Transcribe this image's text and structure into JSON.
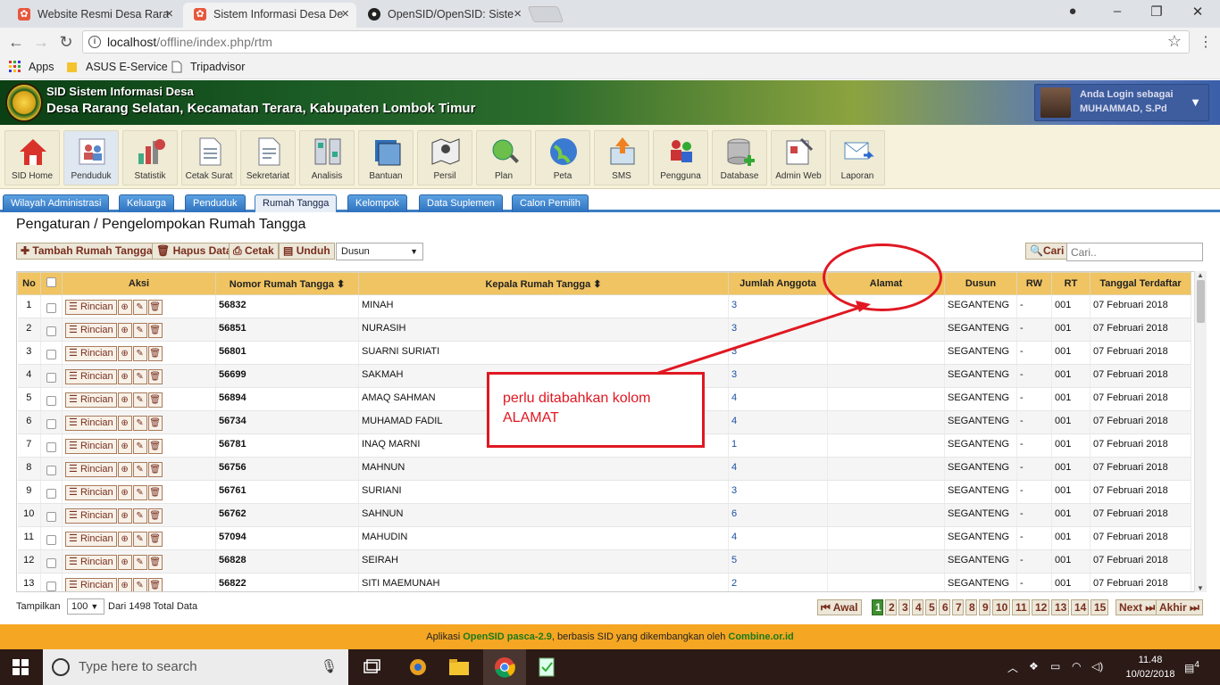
{
  "browser": {
    "tabs": [
      {
        "title": "Website Resmi Desa Rara",
        "favicon_color": "#d9443b"
      },
      {
        "title": "Sistem Informasi Desa De",
        "favicon_color": "#d9443b"
      },
      {
        "title": "OpenSID/OpenSID: Siste",
        "favicon_color": "#222222"
      }
    ],
    "url_host": "localhost",
    "url_path": "/offline/index.php/rtm",
    "bookmarks": [
      "Apps",
      "ASUS E-Service",
      "Tripadvisor"
    ]
  },
  "app": {
    "title": "SID Sistem Informasi Desa",
    "subtitle": "Desa Rarang Selatan, Kecamatan Terara, Kabupaten Lombok Timur",
    "login_label": "Anda Login sebagai",
    "user_name": "MUHAMMAD, S.Pd"
  },
  "modules": [
    {
      "label": "SID Home",
      "icon": "home-icon"
    },
    {
      "label": "Penduduk",
      "icon": "people-icon"
    },
    {
      "label": "Statistik",
      "icon": "chart-icon"
    },
    {
      "label": "Cetak Surat",
      "icon": "document-icon"
    },
    {
      "label": "Sekretariat",
      "icon": "document-icon"
    },
    {
      "label": "Analisis",
      "icon": "analysis-icon"
    },
    {
      "label": "Bantuan",
      "icon": "book-icon"
    },
    {
      "label": "Persil",
      "icon": "map-pin-icon"
    },
    {
      "label": "Plan",
      "icon": "plan-icon"
    },
    {
      "label": "Peta",
      "icon": "globe-icon"
    },
    {
      "label": "SMS",
      "icon": "sms-icon"
    },
    {
      "label": "Pengguna",
      "icon": "users-icon"
    },
    {
      "label": "Database",
      "icon": "database-icon"
    },
    {
      "label": "Admin Web",
      "icon": "admin-icon"
    },
    {
      "label": "Laporan",
      "icon": "mail-icon"
    }
  ],
  "subnav": [
    "Wilayah Administrasi",
    "Keluarga",
    "Penduduk",
    "Rumah Tangga",
    "Kelompok",
    "Data Suplemen",
    "Calon Pemilih"
  ],
  "page_title": "Pengaturan / Pengelompokan Rumah Tangga",
  "actions": {
    "add": "Tambah Rumah Tangga",
    "delete": "Hapus Data",
    "print": "Cetak",
    "download": "Unduh",
    "dusun_select": "Dusun",
    "search_btn": "Cari",
    "search_placeholder": "Cari.."
  },
  "table": {
    "headers": [
      "No",
      "",
      "Aksi",
      "Nomor Rumah Tangga",
      "Kepala Rumah Tangga",
      "Jumlah Anggota",
      "Alamat",
      "Dusun",
      "RW",
      "RT",
      "Tanggal Terdaftar"
    ],
    "rincian_label": "Rincian",
    "rows": [
      {
        "no": "1",
        "nomor": "56832",
        "kepala": "MINAH",
        "jumlah": "3",
        "alamat": "",
        "dusun": "SEGANTENG",
        "rw": "-",
        "rt": "001",
        "tanggal": "07 Februari 2018"
      },
      {
        "no": "2",
        "nomor": "56851",
        "kepala": "NURASIH",
        "jumlah": "3",
        "alamat": "",
        "dusun": "SEGANTENG",
        "rw": "-",
        "rt": "001",
        "tanggal": "07 Februari 2018"
      },
      {
        "no": "3",
        "nomor": "56801",
        "kepala": "SUARNI SURIATI",
        "jumlah": "3",
        "alamat": "",
        "dusun": "SEGANTENG",
        "rw": "-",
        "rt": "001",
        "tanggal": "07 Februari 2018"
      },
      {
        "no": "4",
        "nomor": "56699",
        "kepala": "SAKMAH",
        "jumlah": "3",
        "alamat": "",
        "dusun": "SEGANTENG",
        "rw": "-",
        "rt": "001",
        "tanggal": "07 Februari 2018"
      },
      {
        "no": "5",
        "nomor": "56894",
        "kepala": "AMAQ SAHMAN",
        "jumlah": "4",
        "alamat": "",
        "dusun": "SEGANTENG",
        "rw": "-",
        "rt": "001",
        "tanggal": "07 Februari 2018"
      },
      {
        "no": "6",
        "nomor": "56734",
        "kepala": "MUHAMAD FADIL",
        "jumlah": "4",
        "alamat": "",
        "dusun": "SEGANTENG",
        "rw": "-",
        "rt": "001",
        "tanggal": "07 Februari 2018"
      },
      {
        "no": "7",
        "nomor": "56781",
        "kepala": "INAQ MARNI",
        "jumlah": "1",
        "alamat": "",
        "dusun": "SEGANTENG",
        "rw": "-",
        "rt": "001",
        "tanggal": "07 Februari 2018"
      },
      {
        "no": "8",
        "nomor": "56756",
        "kepala": "MAHNUN",
        "jumlah": "4",
        "alamat": "",
        "dusun": "SEGANTENG",
        "rw": "-",
        "rt": "001",
        "tanggal": "07 Februari 2018"
      },
      {
        "no": "9",
        "nomor": "56761",
        "kepala": "SURIANI",
        "jumlah": "3",
        "alamat": "",
        "dusun": "SEGANTENG",
        "rw": "-",
        "rt": "001",
        "tanggal": "07 Februari 2018"
      },
      {
        "no": "10",
        "nomor": "56762",
        "kepala": "SAHNUN",
        "jumlah": "6",
        "alamat": "",
        "dusun": "SEGANTENG",
        "rw": "-",
        "rt": "001",
        "tanggal": "07 Februari 2018"
      },
      {
        "no": "11",
        "nomor": "57094",
        "kepala": "MAHUDIN",
        "jumlah": "4",
        "alamat": "",
        "dusun": "SEGANTENG",
        "rw": "-",
        "rt": "001",
        "tanggal": "07 Februari 2018"
      },
      {
        "no": "12",
        "nomor": "56828",
        "kepala": "SEIRAH",
        "jumlah": "5",
        "alamat": "",
        "dusun": "SEGANTENG",
        "rw": "-",
        "rt": "001",
        "tanggal": "07 Februari 2018"
      },
      {
        "no": "13",
        "nomor": "56822",
        "kepala": "SITI MAEMUNAH",
        "jumlah": "2",
        "alamat": "",
        "dusun": "SEGANTENG",
        "rw": "-",
        "rt": "001",
        "tanggal": "07 Februari 2018"
      }
    ]
  },
  "annotation": {
    "text": "perlu ditabahkan kolom ALAMAT",
    "color": "#e01822"
  },
  "footer_controls": {
    "tampilkan": "Tampilkan",
    "page_size": "100",
    "total": "Dari 1498 Total Data",
    "first": "Awal",
    "pages": [
      "1",
      "2",
      "3",
      "4",
      "5",
      "6",
      "7",
      "8",
      "9",
      "10",
      "11",
      "12",
      "13",
      "14",
      "15"
    ],
    "current_page": "1",
    "next": "Next",
    "last": "Akhir"
  },
  "app_footer": {
    "prefix": "Aplikasi",
    "app": "OpenSID pasca-2.9",
    "middle": ", berbasis SID yang dikembangkan oleh",
    "org": "Combine.or.id"
  },
  "taskbar": {
    "search_placeholder": "Type here to search",
    "time": "11.48",
    "date": "10/02/2018",
    "notifications": "4"
  }
}
